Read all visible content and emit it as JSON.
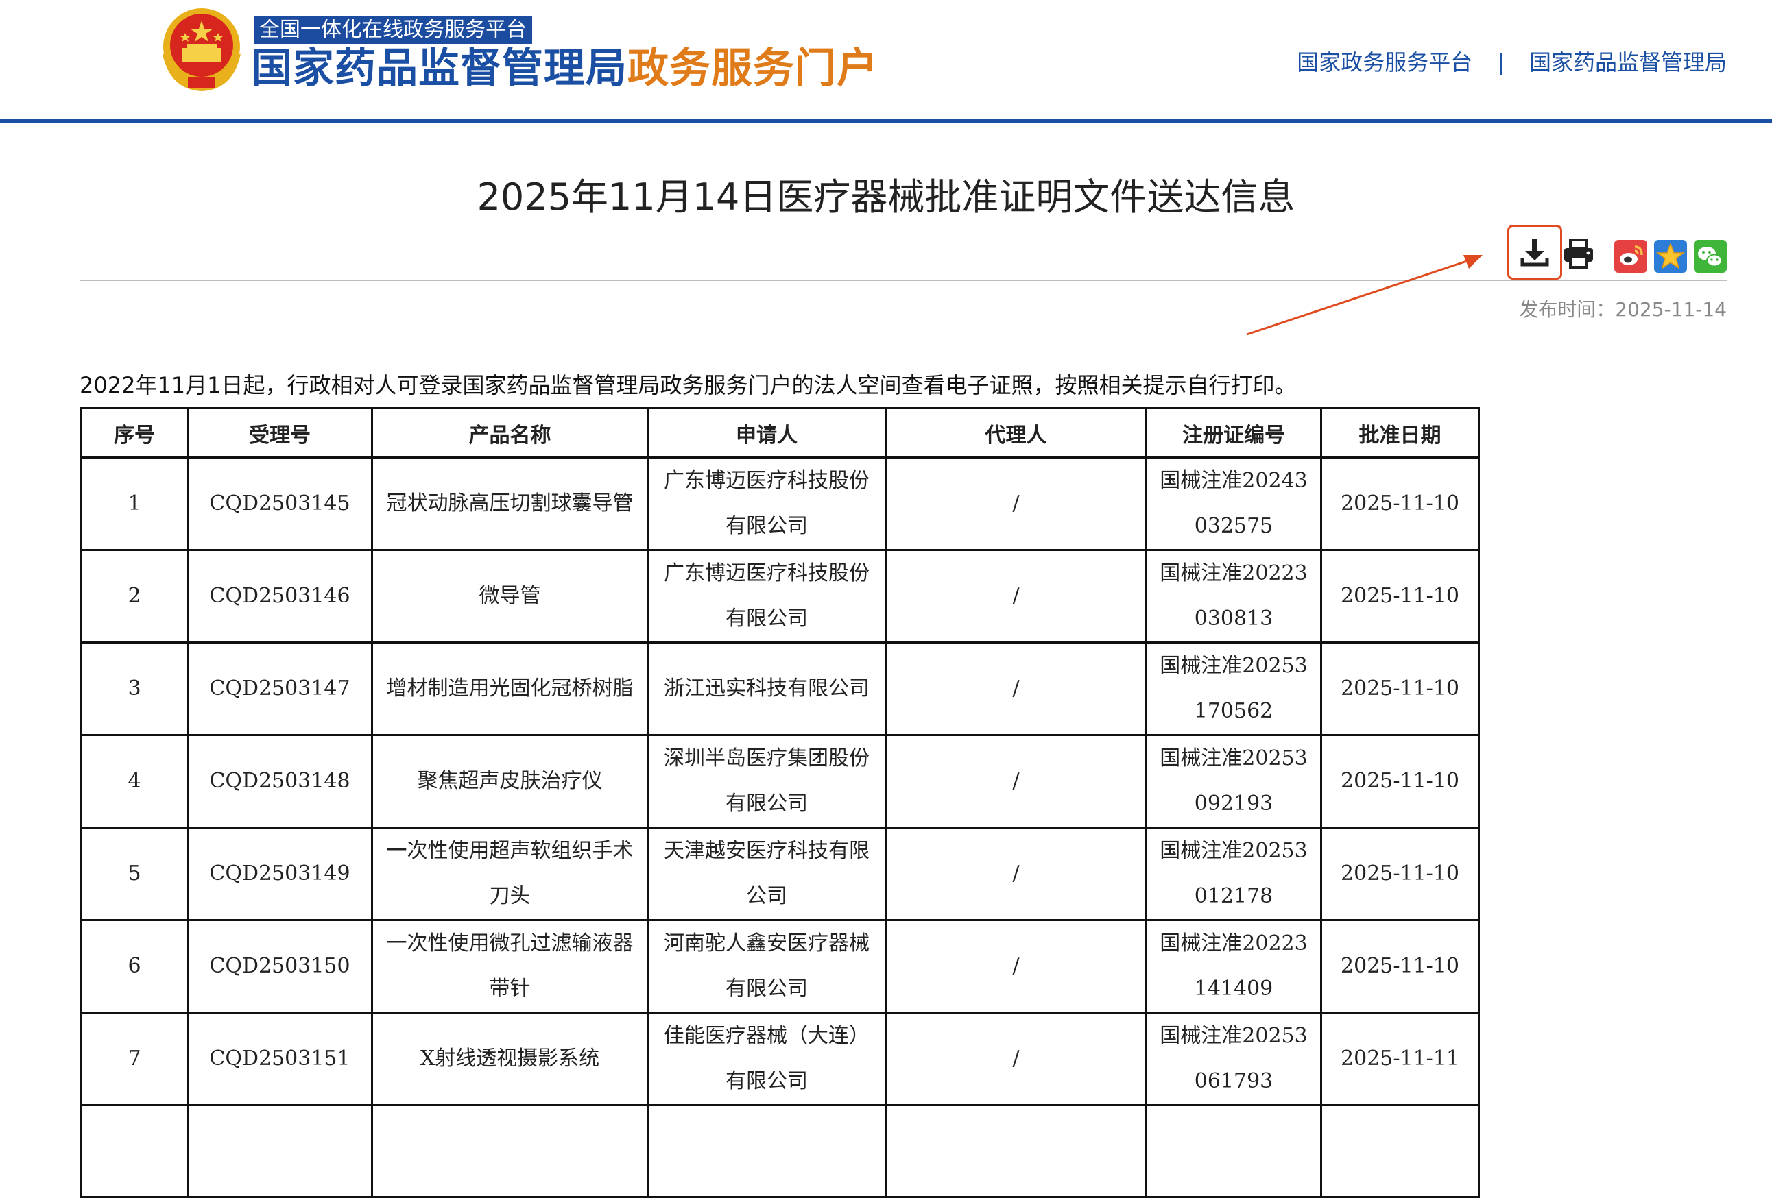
{
  "header": {
    "platform_tag": "全国一体化在线政务服务平台",
    "title_main": "国家药品监督管理局",
    "title_accent": "政务服务门户",
    "links": [
      "国家政务服务平台",
      "国家药品监督管理局"
    ],
    "link_separator": "|"
  },
  "article": {
    "title": "2025年11月14日医疗器械批准证明文件送达信息",
    "publish_time": "发布时间：2025-11-14",
    "notice": "2022年11月1日起，行政相对人可登录国家药品监督管理局政务服务门户的法人空间查看电子证照，按照相关提示自行打印。"
  },
  "tools": {
    "icons": [
      "download-icon",
      "print-icon",
      "weibo-icon",
      "favorite-icon",
      "wechat-icon"
    ],
    "highlight_color": "#e04a1f"
  },
  "colors": {
    "brand_blue": "#1a4fa3",
    "brand_orange": "#e07b1a"
  },
  "table": {
    "headers": [
      "序号",
      "受理号",
      "产品名称",
      "申请人",
      "代理人",
      "注册证编号",
      "批准日期"
    ],
    "rows": [
      [
        "1",
        "CQD2503145",
        "冠状动脉高压切割球囊导管",
        "广东博迈医疗科技股份有限公司",
        "/",
        "国械注准20243032575",
        "2025-11-10"
      ],
      [
        "2",
        "CQD2503146",
        "微导管",
        "广东博迈医疗科技股份有限公司",
        "/",
        "国械注准20223030813",
        "2025-11-10"
      ],
      [
        "3",
        "CQD2503147",
        "增材制造用光固化冠桥树脂",
        "浙江迅实科技有限公司",
        "/",
        "国械注准20253170562",
        "2025-11-10"
      ],
      [
        "4",
        "CQD2503148",
        "聚焦超声皮肤治疗仪",
        "深圳半岛医疗集团股份有限公司",
        "/",
        "国械注准20253092193",
        "2025-11-10"
      ],
      [
        "5",
        "CQD2503149",
        "一次性使用超声软组织手术刀头",
        "天津越安医疗科技有限公司",
        "/",
        "国械注准20253012178",
        "2025-11-10"
      ],
      [
        "6",
        "CQD2503150",
        "一次性使用微孔过滤输液器　　带针",
        "河南驼人鑫安医疗器械有限公司",
        "/",
        "国械注准20223141409",
        "2025-11-10"
      ],
      [
        "7",
        "CQD2503151",
        "X射线透视摄影系统",
        "佳能医疗器械（大连）有限公司",
        "/",
        "国械注准20253061793",
        "2025-11-11"
      ]
    ]
  }
}
